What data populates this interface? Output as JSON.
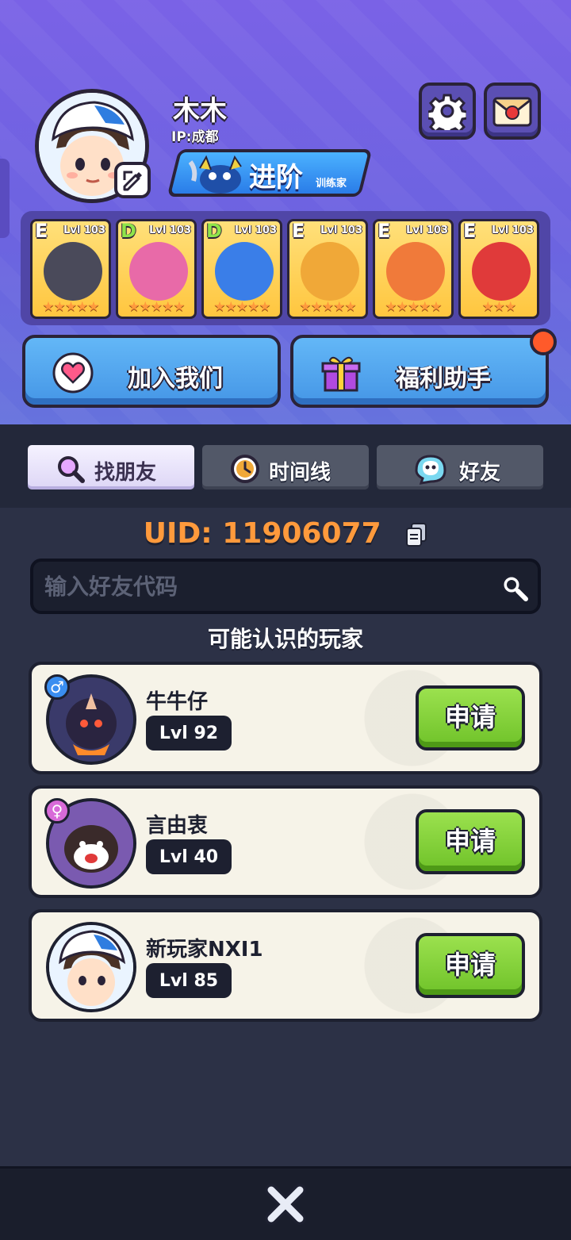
{
  "profile": {
    "name": "木木",
    "ip": "IP:成都",
    "rank_main": "进阶",
    "rank_sub": "训练家"
  },
  "team": [
    {
      "grade": "E",
      "level": "Lvl 103",
      "stars": "★★★★★",
      "color": "#4a4a5a"
    },
    {
      "grade": "D",
      "level": "Lvl 103",
      "stars": "★★★★★",
      "color": "#e86aa8"
    },
    {
      "grade": "D",
      "level": "Lvl 103",
      "stars": "★★★★★",
      "color": "#3a7ee8"
    },
    {
      "grade": "E",
      "level": "Lvl 103",
      "stars": "★★★★★",
      "color": "#f0a838"
    },
    {
      "grade": "E",
      "level": "Lvl 103",
      "stars": "★★★★★",
      "color": "#f07a3a"
    },
    {
      "grade": "E",
      "level": "Lvl 103",
      "stars": "★★★",
      "color": "#e03a3a"
    }
  ],
  "buttons": {
    "join": "加入我们",
    "welfare": "福利助手"
  },
  "tabs": [
    {
      "label": "找朋友",
      "icon": "magnifier-icon"
    },
    {
      "label": "时间线",
      "icon": "clock-icon"
    },
    {
      "label": "好友",
      "icon": "ghost-icon"
    }
  ],
  "uid": {
    "text": "UID:  11906077"
  },
  "search": {
    "placeholder": "输入好友代码"
  },
  "section_title": "可能认识的玩家",
  "players": [
    {
      "name": "牛牛仔",
      "level": "Lvl 92",
      "gender": "♂",
      "gender_color": "#3a8ef0",
      "avatar_color": "#3a3a6a",
      "apply": "申请"
    },
    {
      "name": "言由衷",
      "level": "Lvl 40",
      "gender": "♀",
      "gender_color": "#d86ad8",
      "avatar_color": "#7a5ab0",
      "apply": "申请"
    },
    {
      "name": "新玩家NXI1",
      "level": "Lvl 85",
      "gender": "",
      "gender_color": "",
      "avatar_color": "#8fd0f0",
      "apply": "申请"
    }
  ],
  "colors": {
    "accent_orange": "#ff9a3c",
    "header_purple": "#7a62e6",
    "apply_green": "#6fc229"
  }
}
